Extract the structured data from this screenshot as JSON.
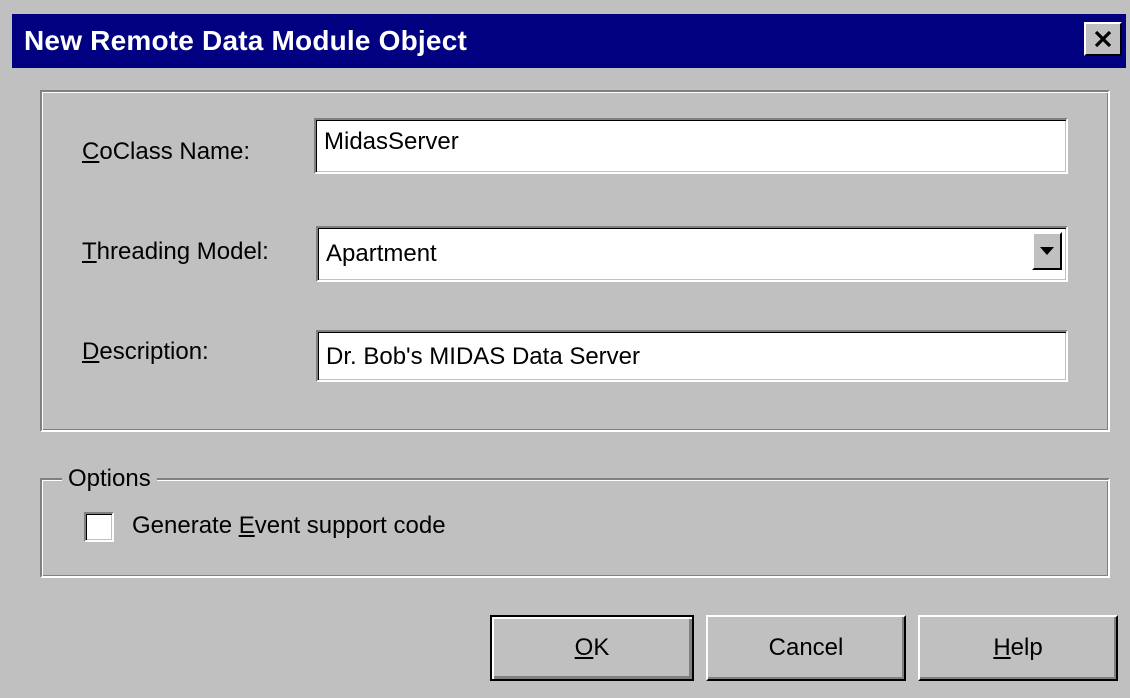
{
  "window": {
    "title": "New Remote Data Module Object",
    "close_icon": "close-icon"
  },
  "form": {
    "coclass": {
      "label_mnemonic": "C",
      "label_rest": "oClass Name:",
      "value": "MidasServer"
    },
    "threading": {
      "label_mnemonic": "T",
      "label_rest": "hreading Model:",
      "value": "Apartment",
      "dropdown_icon": "chevron-down-icon"
    },
    "description": {
      "label_mnemonic": "D",
      "label_rest": "escription:",
      "value": "Dr. Bob's MIDAS Data Server"
    }
  },
  "options": {
    "legend": "Options",
    "event_support": {
      "label_before": "Generate ",
      "label_mnemonic": "E",
      "label_after": "vent support code",
      "checked": false
    }
  },
  "buttons": {
    "ok_mnemonic": "O",
    "ok_rest": "K",
    "cancel": "Cancel",
    "help_mnemonic": "H",
    "help_rest": "elp"
  },
  "colors": {
    "title_bar": "#000080",
    "face": "#c0c0c0"
  }
}
